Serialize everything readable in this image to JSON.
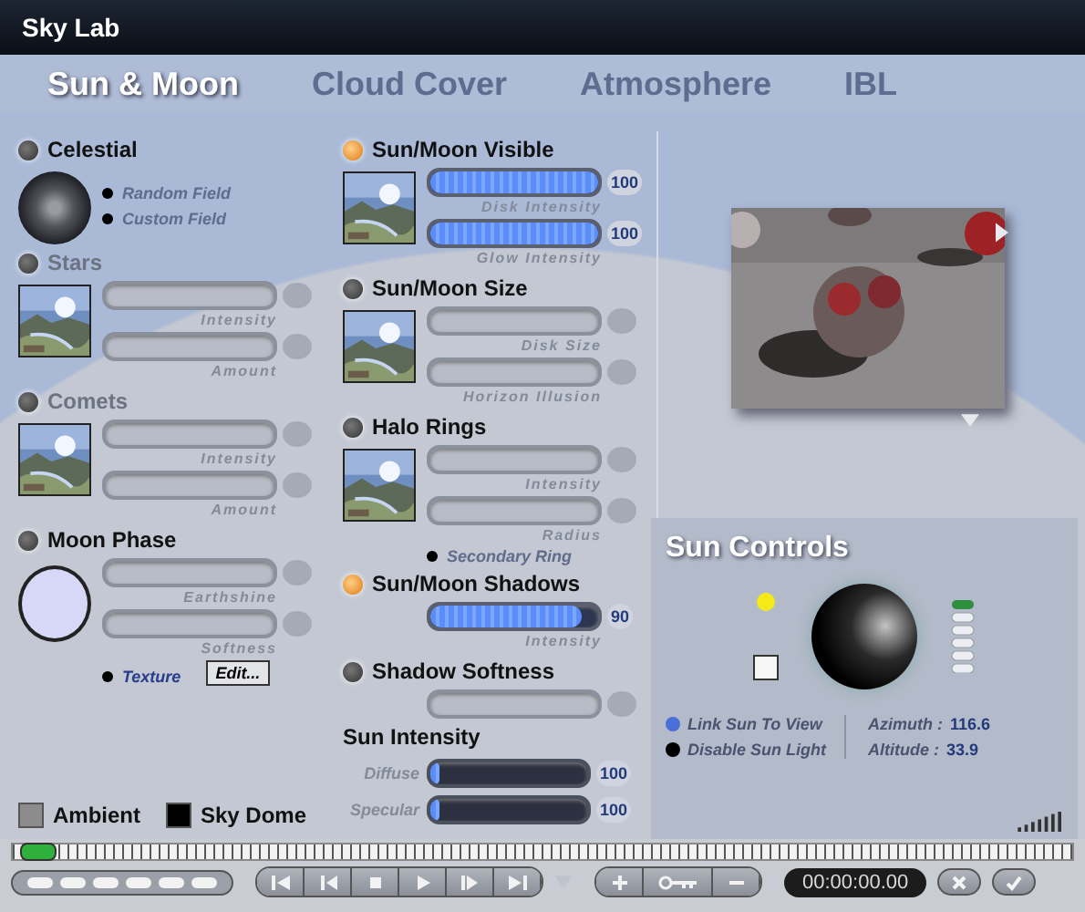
{
  "window": {
    "title": "Sky Lab"
  },
  "tabs": [
    {
      "label": "Sun & Moon",
      "selected": true
    },
    {
      "label": "Cloud Cover",
      "selected": false
    },
    {
      "label": "Atmosphere",
      "selected": false
    },
    {
      "label": "IBL",
      "selected": false
    }
  ],
  "left_panel": {
    "sections": [
      {
        "title": "Celestial",
        "on": false,
        "disabled": false,
        "kind": "orb",
        "options": [
          "Random Field",
          "Custom Field"
        ]
      },
      {
        "title": "Stars",
        "on": false,
        "disabled": true,
        "kind": "thumb",
        "sliders": [
          {
            "label": "Intensity",
            "kind": "below",
            "disabled": true
          },
          {
            "label": "Amount",
            "kind": "below",
            "disabled": true
          }
        ]
      },
      {
        "title": "Comets",
        "on": false,
        "disabled": true,
        "kind": "thumb",
        "sliders": [
          {
            "label": "Intensity",
            "kind": "below",
            "disabled": true
          },
          {
            "label": "Amount",
            "kind": "below",
            "disabled": true
          }
        ]
      },
      {
        "title": "Moon Phase",
        "on": false,
        "disabled": false,
        "kind": "moon",
        "sliders": [
          {
            "label": "Earthshine",
            "kind": "below",
            "disabled": true
          },
          {
            "label": "Softness",
            "kind": "below",
            "disabled": true
          }
        ],
        "options": [
          "Texture"
        ],
        "button": "Edit..."
      }
    ],
    "swatches": [
      {
        "label": "Ambient",
        "color": "#8c8c8c"
      },
      {
        "label": "Sky Dome",
        "color": "#000000"
      }
    ]
  },
  "middle_panel": {
    "sections": [
      {
        "title": "Sun/Moon Visible",
        "on": true,
        "kind": "thumb",
        "sliders": [
          {
            "label": "Disk Intensity",
            "kind": "below",
            "disabled": false,
            "level": 1,
            "reading": "100"
          },
          {
            "label": "Glow Intensity",
            "kind": "below",
            "disabled": false,
            "level": 1,
            "reading": "100"
          }
        ]
      },
      {
        "title": "Sun/Moon Size",
        "on": false,
        "kind": "thumb",
        "sliders": [
          {
            "label": "Disk Size",
            "kind": "below",
            "disabled": true
          },
          {
            "label": "Horizon Illusion",
            "kind": "below",
            "disabled": true
          }
        ]
      },
      {
        "title": "Halo Rings",
        "on": false,
        "kind": "thumb",
        "sliders": [
          {
            "label": "Intensity",
            "kind": "below",
            "disabled": true
          },
          {
            "label": "Radius",
            "kind": "below",
            "disabled": true
          }
        ],
        "options": [
          "Secondary Ring"
        ]
      },
      {
        "title": "Sun/Moon Shadows",
        "on": true,
        "kind": "none",
        "sliders": [
          {
            "label": "Intensity",
            "kind": "below",
            "disabled": false,
            "level": 0.9,
            "reading": "90"
          }
        ]
      },
      {
        "title": "Shadow Softness",
        "on": false,
        "kind": "none",
        "sliders": [
          {
            "kind": "below",
            "disabled": true
          }
        ]
      },
      {
        "title": "Sun Intensity",
        "kind": "plain",
        "sliders": [
          {
            "label": "Diffuse",
            "kind": "side",
            "level": 0.06,
            "reading": "100"
          },
          {
            "label": "Specular",
            "kind": "side",
            "level": 0.06,
            "reading": "100"
          }
        ]
      }
    ]
  },
  "sun_controls": {
    "title": "Sun Controls",
    "options": [
      {
        "label": "Link Sun To View",
        "color": "#4a6fd8"
      },
      {
        "label": "Disable Sun Light",
        "color": "#000000"
      }
    ],
    "readouts": [
      {
        "label": "Azimuth :",
        "value": "116.6"
      },
      {
        "label": "Altitude :",
        "value": "33.9"
      }
    ]
  },
  "transport": {
    "time": "00:00:00.00"
  }
}
